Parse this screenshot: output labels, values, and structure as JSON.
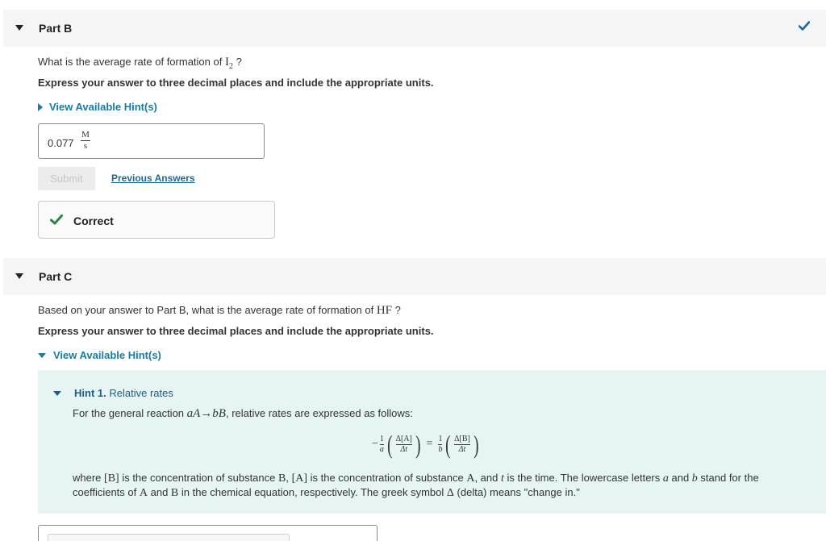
{
  "part_b": {
    "title": "Part B",
    "question_prefix": "What is the average rate of formation of ",
    "question_species": "I",
    "question_subscript": "2",
    "question_suffix": " ?",
    "instruction": "Express your answer to three decimal places and include the appropriate units.",
    "hint_toggle": "View Available Hint(s)",
    "answer_value": "0.077",
    "answer_unit_num": "M",
    "answer_unit_den": "s",
    "submit_label": "Submit",
    "previous_answers_label": "Previous Answers",
    "feedback": "Correct",
    "status_color": "#1a6a96"
  },
  "part_c": {
    "title": "Part C",
    "question_prefix": "Based on your answer to Part B, what is the average rate of formation of ",
    "question_species": "HF",
    "question_suffix": " ?",
    "instruction": "Express your answer to three decimal places and include the appropriate units.",
    "hint_toggle": "View Available Hint(s)",
    "hint": {
      "number_label": "Hint 1.",
      "title": "Relative rates",
      "intro_prefix": "For the general reaction ",
      "reaction": "aA→bB",
      "intro_suffix": ", relative rates are expressed as follows:",
      "eq_minus": "−",
      "eq_a_num": "1",
      "eq_a_den": "a",
      "eq_lhs_num": "Δ[A]",
      "eq_lhs_den": "Δt",
      "eq_equals": "=",
      "eq_b_num": "1",
      "eq_b_den": "b",
      "eq_rhs_num": "Δ[B]",
      "eq_rhs_den": "Δt",
      "desc_1": "where ",
      "desc_B": "[B]",
      "desc_2": " is the concentration of substance ",
      "desc_Bsub": "B",
      "desc_3": ", ",
      "desc_A": "[A]",
      "desc_4": " is the concentration of substance ",
      "desc_Asub": "A",
      "desc_5": ", and ",
      "desc_t": "t",
      "desc_6": " is the time. The lowercase letters ",
      "desc_a": "a",
      "desc_7": " and ",
      "desc_b": "b",
      "desc_8": " stand for the coefficients of ",
      "desc_A2": "A",
      "desc_9": " and ",
      "desc_B2": "B",
      "desc_10": " in the chemical equation, respectively. The greek symbol ",
      "desc_delta": "Δ",
      "desc_11": " (delta) means \"change in.\""
    }
  },
  "colors": {
    "link": "#1a7aa0",
    "check": "#1a6a96",
    "correct_check": "#2e8540",
    "hint_bg": "#e6f4f4"
  }
}
